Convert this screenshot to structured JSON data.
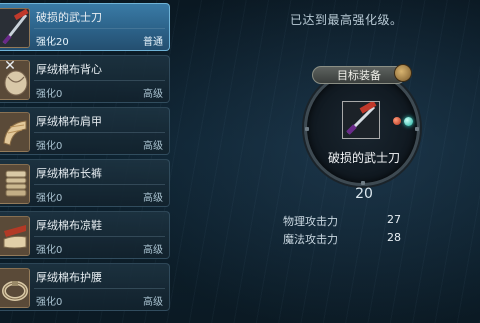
{
  "items": [
    {
      "name": "破损的武士刀",
      "level": "强化20",
      "grade": "普通",
      "icon": "katana-icon"
    },
    {
      "name": "厚绒棉布背心",
      "level": "强化0",
      "grade": "高级",
      "icon": "vest-icon"
    },
    {
      "name": "厚绒棉布肩甲",
      "level": "强化0",
      "grade": "高级",
      "icon": "shoulder-icon"
    },
    {
      "name": "厚绒棉布长裤",
      "level": "强化0",
      "grade": "高级",
      "icon": "pants-icon"
    },
    {
      "name": "厚绒棉布凉鞋",
      "level": "强化0",
      "grade": "高级",
      "icon": "sandals-icon"
    },
    {
      "name": "厚绒棉布护腰",
      "level": "强化0",
      "grade": "高级",
      "icon": "belt-icon"
    }
  ],
  "close_glyph": "✕",
  "panel": {
    "max_message": "已达到最高强化级。",
    "target_title": "目标装备",
    "target_name": "破损的武士刀",
    "target_level": "20",
    "stats": [
      {
        "label": "物理攻击力",
        "value": "27"
      },
      {
        "label": "魔法攻击力",
        "value": "28"
      }
    ]
  },
  "colors": {
    "selected_item": "#2c6289",
    "gem_red": "#b3321c",
    "gem_cyan": "#20b2a3"
  }
}
